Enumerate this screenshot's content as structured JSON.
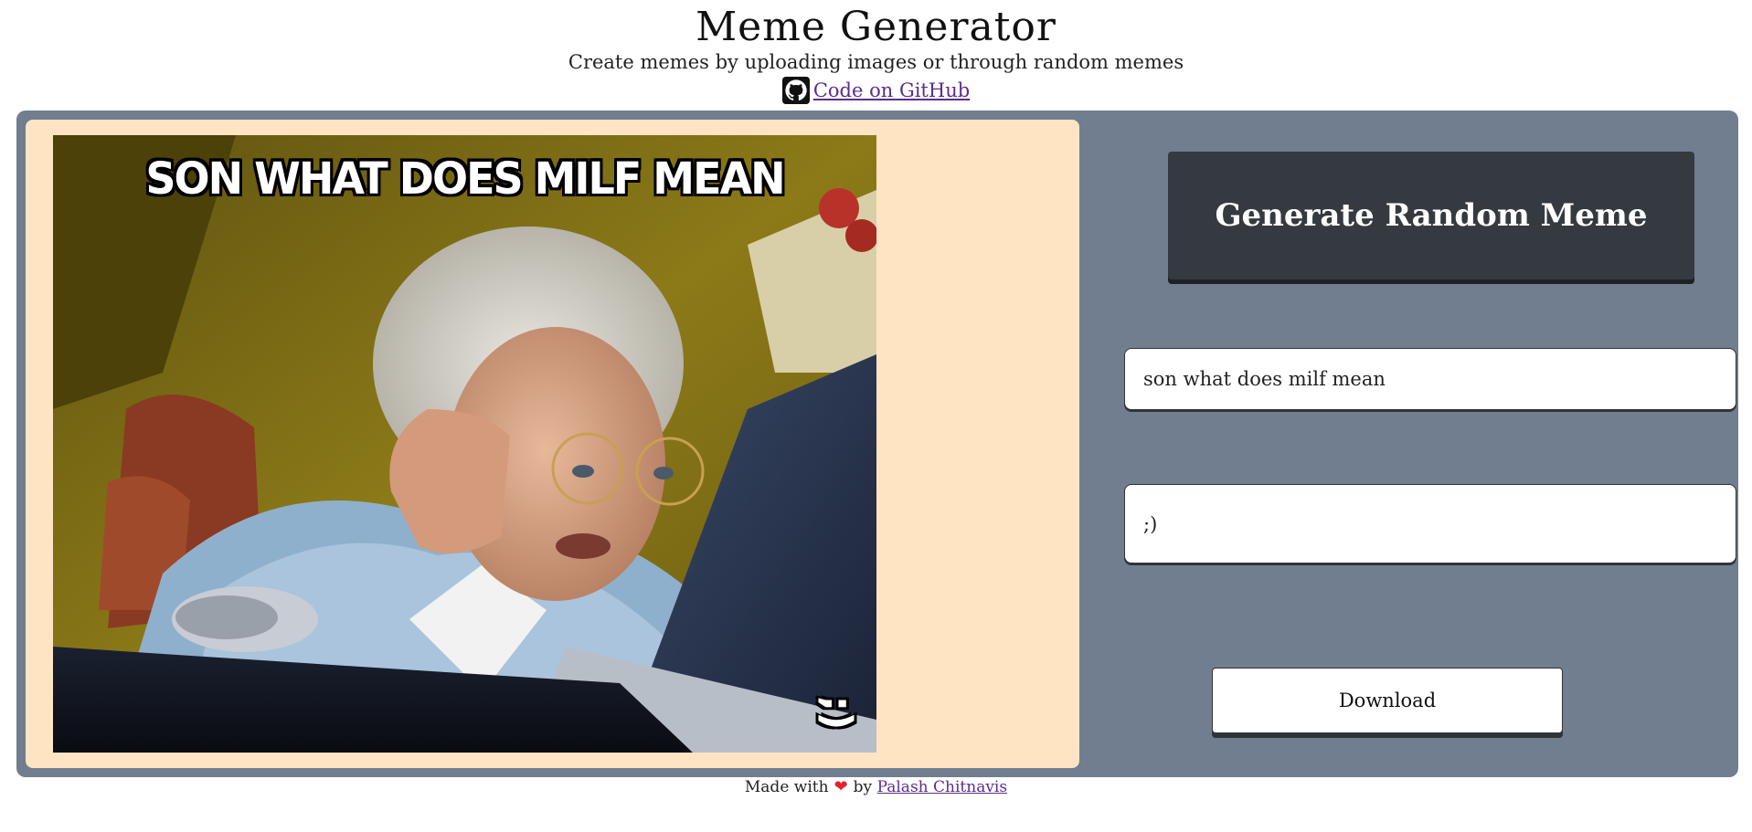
{
  "header": {
    "title": "Meme Generator",
    "subtitle": "Create memes by uploading images or through random memes",
    "github_link": "Code on GitHub",
    "github_icon": "github-octocat-icon"
  },
  "meme": {
    "top_text": "SON WHAT DOES MILF MEAN",
    "bottom_text": ";)",
    "image_description_icon": "meme-image"
  },
  "controls": {
    "generate_label": "Generate Random Meme",
    "top_text_value": "son what does milf mean",
    "bottom_text_value": ";)",
    "download_label": "Download"
  },
  "footer": {
    "made_with": "Made with",
    "heart_icon": "heart-icon",
    "by": "by",
    "author": "Palash Chitnavis"
  },
  "colors": {
    "panel": "#707e8f",
    "canvas_bg": "#ffe4c4",
    "generate_button": "#343a40",
    "link": "#5b2d8e",
    "heart": "#e0242e"
  }
}
